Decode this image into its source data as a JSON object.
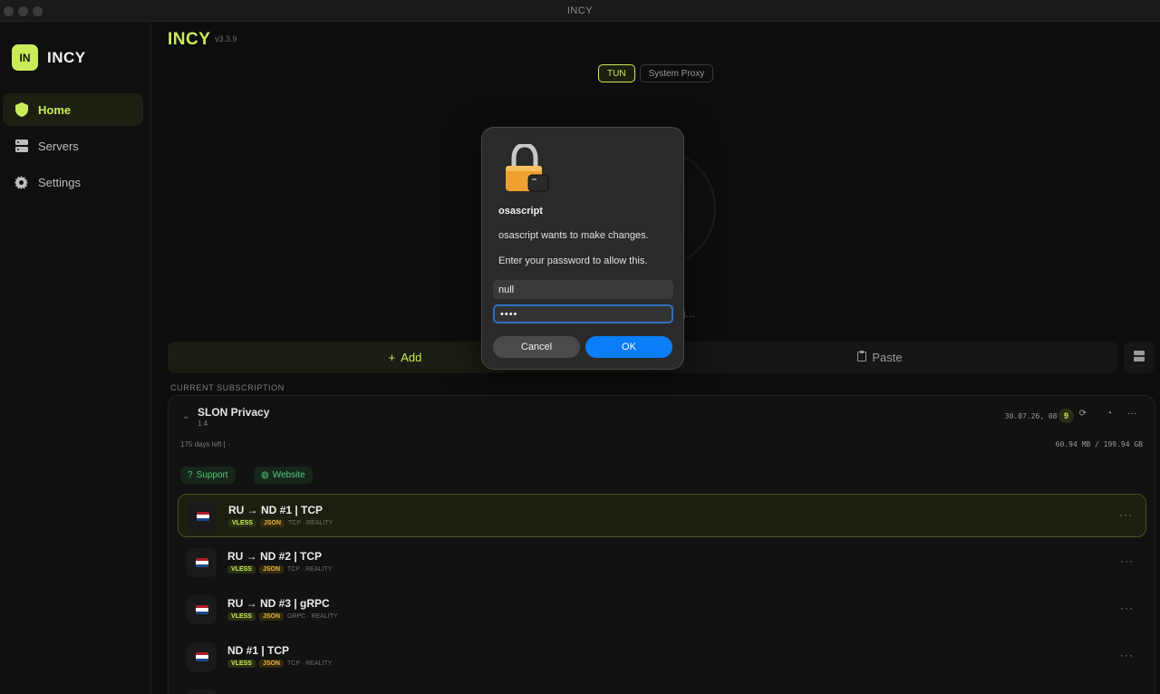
{
  "window": {
    "title": "INCY"
  },
  "sidebar": {
    "brand_logo": "IN",
    "brand_name": "INCY",
    "items": [
      {
        "label": "Home",
        "icon": "shield-icon",
        "active": true
      },
      {
        "label": "Servers",
        "icon": "server-icon",
        "active": false
      },
      {
        "label": "Settings",
        "icon": "gear-icon",
        "active": false
      }
    ]
  },
  "header": {
    "title": "INCY",
    "version": "v3.3.9"
  },
  "modes": {
    "tun": "TUN",
    "system_proxy": "System Proxy",
    "active": "TUN"
  },
  "status_text": "g...",
  "actions": {
    "add_label": "Add",
    "paste_label": "Paste"
  },
  "subscription": {
    "section_label": "CURRENT SUBSCRIPTION",
    "name": "SLON Privacy",
    "subtitle": "1 4",
    "updated": "30.07.26, 08:10",
    "server_count": "9",
    "days_left": "175 days left  |  ·",
    "traffic": "60.94 MB / 199.94 GB",
    "support_label": "Support",
    "website_label": "Website"
  },
  "servers": [
    {
      "name": "RU → ND #1 | TCP",
      "tag1": "VLESS",
      "tag2": "JSON",
      "meta": "TCP · REALITY",
      "active": true
    },
    {
      "name": "RU → ND #2 | TCP",
      "tag1": "VLESS",
      "tag2": "JSON",
      "meta": "TCP · REALITY",
      "active": false
    },
    {
      "name": "RU → ND #3 | gRPC",
      "tag1": "VLESS",
      "tag2": "JSON",
      "meta": "GRPC · REALITY",
      "active": false
    },
    {
      "name": "ND #1 | TCP",
      "tag1": "VLESS",
      "tag2": "JSON",
      "meta": "TCP · REALITY",
      "active": false
    }
  ],
  "dialog": {
    "app": "osascript",
    "message": "osascript wants to make changes.",
    "prompt": "Enter your password to allow this.",
    "username": "null",
    "password_masked": "••••",
    "cancel": "Cancel",
    "ok": "OK"
  },
  "colors": {
    "accent": "#c9ec5a",
    "ok_button": "#0a7df7",
    "link_green": "#4fc97a"
  }
}
